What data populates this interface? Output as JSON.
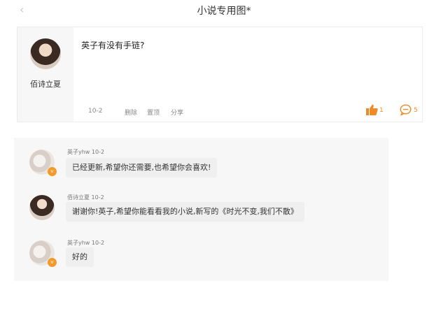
{
  "header": {
    "back_icon": "chevron-left-icon",
    "back_glyph": "‹",
    "title": "小说专用图*"
  },
  "post": {
    "author": "佰诗立夏",
    "text": "英子有没有手链?",
    "date": "10-2",
    "actions": {
      "delete": "删除",
      "pin": "置顶",
      "share": "分享"
    },
    "likes": "1",
    "comments": "5",
    "accent_color": "#f08a24"
  },
  "replies": [
    {
      "author": "英子yhw",
      "date": "10-2",
      "text": "已经更新,希望你还需要,也希望你会喜欢!",
      "vip_badge": "v"
    },
    {
      "author": "佰诗立夏",
      "date": "10-2",
      "text": "谢谢你!英子,希望你能看看我的小说,新写的《时光不变,我们不散》"
    },
    {
      "author": "英子yhw",
      "date": "10-2",
      "text": "好的",
      "vip_badge": "v"
    }
  ]
}
